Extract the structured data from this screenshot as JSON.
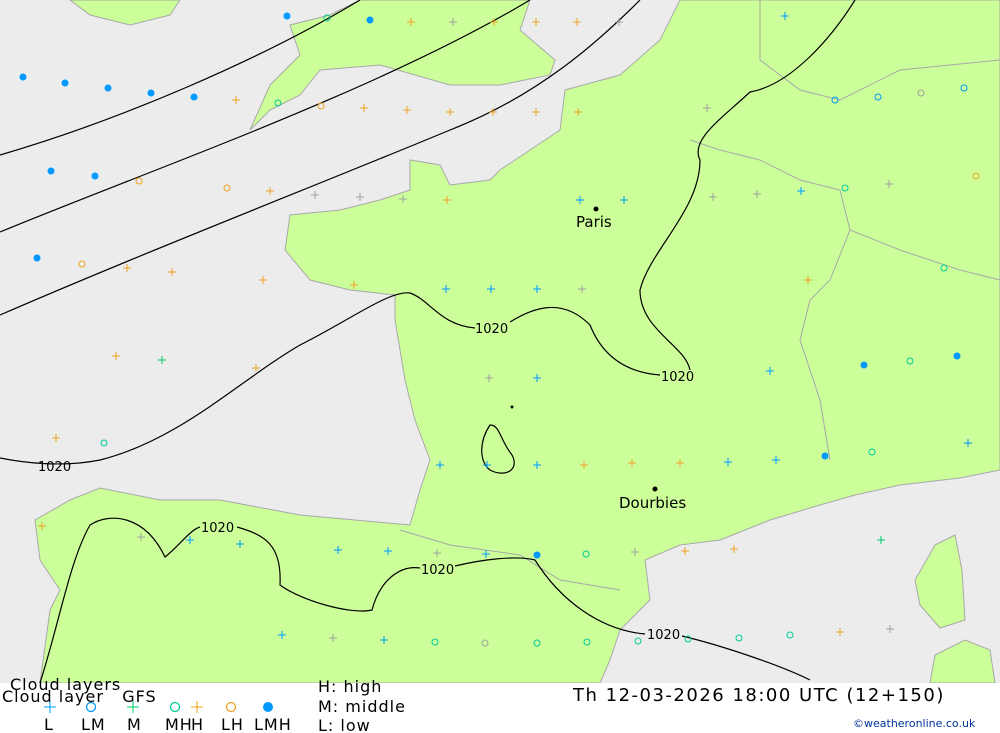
{
  "map": {
    "cities": [
      {
        "name": "Paris"
      },
      {
        "name": "Dourbies"
      }
    ],
    "isobar_label": "1020",
    "colors": {
      "land": "#ccff99",
      "sea": "#ececec",
      "coast": "#a8a8a8",
      "low": "#0099ff",
      "middle": "#00cc66",
      "mh": "#00cc99",
      "high": "#f0a020",
      "other": "#a0a0a0"
    }
  },
  "footer": {
    "title1": "Cloud layers",
    "title2": "Cloud layer   GFS",
    "legend": [
      {
        "label": "L",
        "symbol": "plus",
        "color": "#0099ff"
      },
      {
        "label": "LM",
        "symbol": "circle",
        "color": "#0099ff"
      },
      {
        "label": "M",
        "symbol": "plus",
        "color": "#00cc66"
      },
      {
        "label": "MH",
        "symbol": "circle",
        "color": "#00cc99"
      },
      {
        "label": "H",
        "symbol": "plus",
        "color": "#f0a020"
      },
      {
        "label": "LH",
        "symbol": "circle",
        "color": "#f0a020"
      },
      {
        "label": "LMH",
        "symbol": "dot",
        "color": "#0099ff"
      }
    ],
    "key_high": "H: high",
    "key_middle": "M: middle",
    "key_low": "L: low",
    "datetime": "Th 12-03-2026 18:00 UTC (12+150)",
    "credit": "©weatheronline.co.uk"
  }
}
